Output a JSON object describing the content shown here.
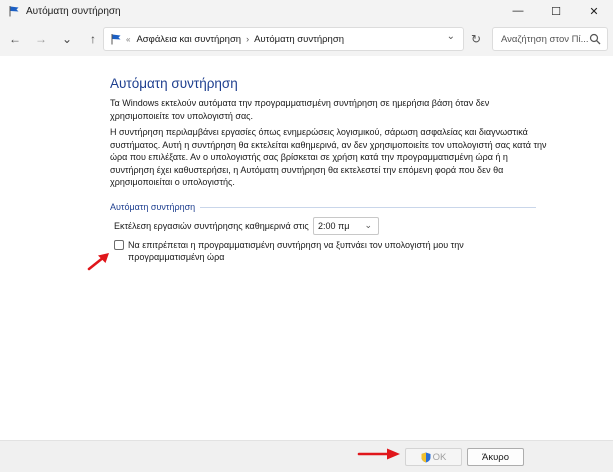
{
  "window": {
    "title": "Αυτόματη συντήρηση",
    "minimize_glyph": "—",
    "maximize_glyph": "☐",
    "close_glyph": "✕"
  },
  "nav": {
    "back_glyph": "←",
    "forward_glyph": "→",
    "recent_glyph": "⌄",
    "up_glyph": "↑",
    "refresh_glyph": "↻",
    "address": {
      "overflow": "«",
      "crumb_1": "Ασφάλεια και συντήρηση",
      "separator": "›",
      "crumb_2": "Αυτόματη συντήρηση",
      "dropdown_glyph": "⌄"
    },
    "search": {
      "placeholder": "Αναζήτηση στον Πί..."
    }
  },
  "content": {
    "title": "Αυτόματη συντήρηση",
    "paragraph_1": "Τα Windows εκτελούν αυτόματα την προγραμματισμένη συντήρηση σε ημερήσια βάση όταν δεν χρησιμοποιείτε τον υπολογιστή σας.",
    "paragraph_2": "Η συντήρηση περιλαμβάνει εργασίες όπως ενημερώσεις λογισμικού, σάρωση ασφαλείας και διαγνωστικά συστήματος. Αυτή η συντήρηση θα εκτελείται καθημερινά, αν δεν χρησιμοποιείτε τον υπολογιστή σας κατά την ώρα που επιλέξατε. Αν ο υπολογιστής σας βρίσκεται σε χρήση κατά την προγραμματισμένη ώρα ή η συντήρηση έχει καθυστερήσει, η Αυτόματη συντήρηση θα εκτελεστεί την επόμενη φορά που δεν θα χρησιμοποιείται ο υπολογιστής.",
    "section_label": "Αυτόματη συντήρηση",
    "run_label": "Εκτέλεση εργασιών συντήρησης καθημερινά στις",
    "time_value": "2:00 πμ",
    "time_chevron": "⌄",
    "wake_checkbox_label": "Να επιτρέπεται η προγραμματισμένη συντήρηση να ξυπνάει τον υπολογιστή μου την προγραμματισμένη ώρα",
    "wake_checked": false
  },
  "footer": {
    "ok_label": "OK",
    "cancel_label": "Άκυρο"
  },
  "colors": {
    "title_blue": "#1e3f8f",
    "annotation_red": "#e0161b"
  }
}
